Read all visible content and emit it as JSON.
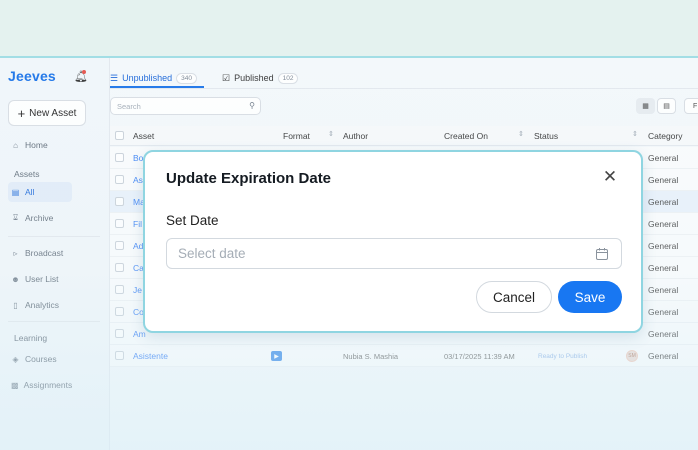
{
  "app": {
    "logo": "Jeeves"
  },
  "sidebar": {
    "new_asset": "New Asset",
    "home": "Home",
    "assets_section": "Assets",
    "all": "All",
    "archive": "Archive",
    "broadcast": "Broadcast",
    "user_list": "User List",
    "analytics": "Analytics",
    "learning_section": "Learning",
    "courses": "Courses",
    "assignments": "Assignments"
  },
  "tabs": [
    {
      "label": "Unpublished",
      "count": "340"
    },
    {
      "label": "Published",
      "count": "102"
    }
  ],
  "search": {
    "placeholder": "Search"
  },
  "toolbar": {
    "filter_partial": "F"
  },
  "table": {
    "headers": {
      "asset": "Asset",
      "format": "Format",
      "author": "Author",
      "created_on": "Created On",
      "status": "Status",
      "category": "Category"
    },
    "rows": [
      {
        "asset": "Bo",
        "category": "General"
      },
      {
        "asset": "As",
        "category": "General"
      },
      {
        "asset": "Ma",
        "category": "General"
      },
      {
        "asset": "Fil",
        "category": "General"
      },
      {
        "asset": "Ad",
        "category": "General"
      },
      {
        "asset": "Ca",
        "category": "General"
      },
      {
        "asset": "Je",
        "category": "General"
      },
      {
        "asset": "Co",
        "category": "General"
      },
      {
        "asset": "Am",
        "category": "General"
      },
      {
        "asset": "Asistente",
        "author": "Nubia S. Mashia",
        "created_on": "03/17/2025 11:39 AM",
        "status": "Ready to Publish",
        "avatar": "SM",
        "category": "General"
      }
    ]
  },
  "modal": {
    "title": "Update Expiration Date",
    "field_label": "Set Date",
    "date_placeholder": "Select date",
    "date_value": "",
    "cancel": "Cancel",
    "save": "Save",
    "close_icon": "close-icon",
    "calendar_icon": "calendar-icon"
  },
  "colors": {
    "accent": "#1877f2",
    "modal_border": "#8fd5e1",
    "link": "#3b82f6"
  }
}
